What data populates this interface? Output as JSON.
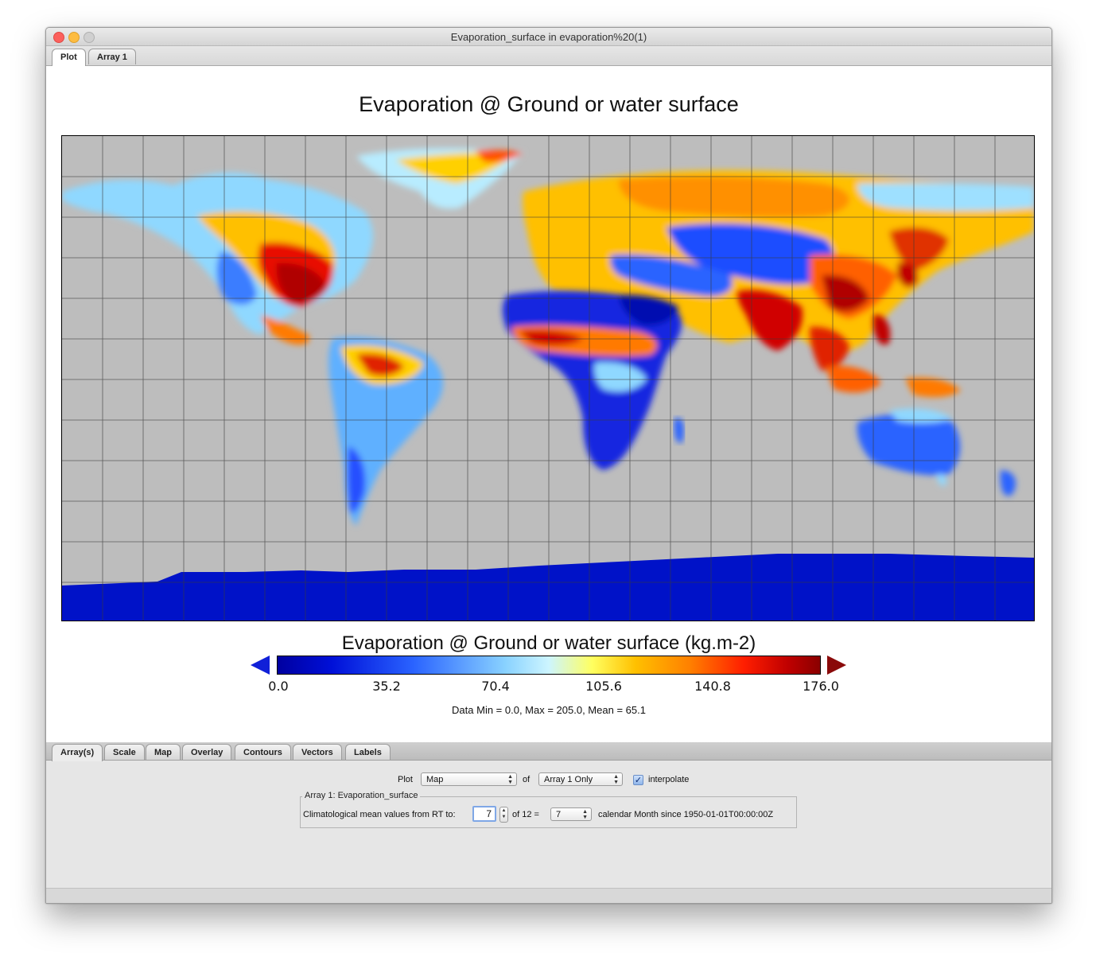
{
  "window": {
    "title": "Evaporation_surface in evaporation%20(1)"
  },
  "top_tabs": [
    {
      "label": "Plot",
      "active": true
    },
    {
      "label": "Array 1",
      "active": false
    }
  ],
  "plot": {
    "title": "Evaporation @ Ground or water surface",
    "colorbar_title": "Evaporation @ Ground or water surface (kg.m-2)",
    "colorbar_ticks": [
      "0.0",
      "35.2",
      "70.4",
      "105.6",
      "140.8",
      "176.0"
    ],
    "stats": "Data Min = 0.0, Max = 205.0, Mean = 65.1",
    "colors": {
      "ocean": "#bdbdbd",
      "low": "#0010d8",
      "high": "#8a0000"
    }
  },
  "bottom_tabs": [
    {
      "label": "Array(s)",
      "active": true
    },
    {
      "label": "Scale"
    },
    {
      "label": "Map"
    },
    {
      "label": "Overlay"
    },
    {
      "label": "Contours"
    },
    {
      "label": "Vectors"
    },
    {
      "label": "Labels"
    }
  ],
  "controls": {
    "plot_label": "Plot",
    "plot_select": "Map",
    "of_label": "of",
    "array_select": "Array 1 Only",
    "interpolate_label": "interpolate",
    "interpolate_checked": true,
    "group_title": "Array 1: Evaporation_surface",
    "clim_label": "Climatological mean values from RT to:",
    "clim_value": "7",
    "of_total": "of 12 =",
    "month_select": "7",
    "since_label": "calendar Month since 1950-01-01T00:00:00Z"
  }
}
